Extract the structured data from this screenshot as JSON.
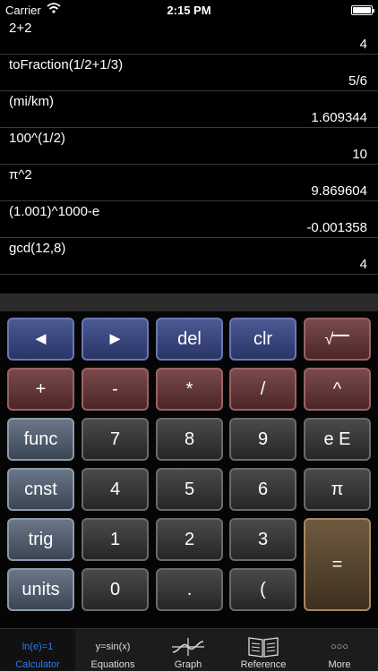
{
  "status": {
    "carrier": "Carrier",
    "time": "2:15 PM"
  },
  "history": [
    {
      "expr": "2+2",
      "result": "4"
    },
    {
      "expr": "toFraction(1/2+1/3)",
      "result": "5/6"
    },
    {
      "expr": "(mi/km)",
      "result": "1.609344"
    },
    {
      "expr": "100^(1/2)",
      "result": "10"
    },
    {
      "expr": "π^2",
      "result": "9.869604"
    },
    {
      "expr": "(1.001)^1000-e",
      "result": "-0.001358"
    },
    {
      "expr": "gcd(12,8)",
      "result": "4"
    }
  ],
  "keys": {
    "left": "◄",
    "right": "►",
    "del": "del",
    "clr": "clr",
    "sqrt": "√",
    "plus": "+",
    "minus": "-",
    "times": "*",
    "divide": "/",
    "power": "^",
    "func": "func",
    "seven": "7",
    "eight": "8",
    "nine": "9",
    "ee": "e E",
    "cnst": "cnst",
    "four": "4",
    "five": "5",
    "six": "6",
    "pi": "π",
    "trig": "trig",
    "one": "1",
    "two": "2",
    "three": "3",
    "equals": "=",
    "units": "units",
    "zero": "0",
    "dot": ".",
    "paren": "("
  },
  "tabs": {
    "calculator": {
      "icon_text": "ln(e)=1",
      "label": "Calculator"
    },
    "equations": {
      "icon_text": "y=sin(x)",
      "label": "Equations"
    },
    "graph": {
      "label": "Graph"
    },
    "reference": {
      "label": "Reference"
    },
    "more": {
      "icon_text": "○○○",
      "label": "More"
    }
  },
  "colors": {
    "active_tab": "#2b7cf0",
    "orange_key_border": "#a8885b"
  }
}
